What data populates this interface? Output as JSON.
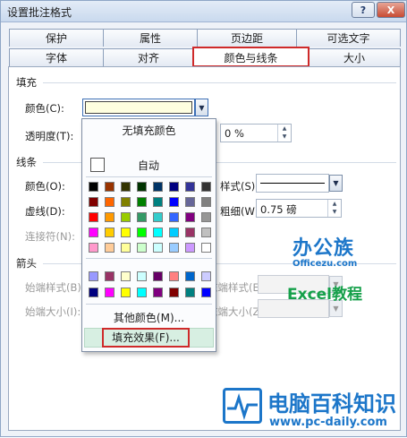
{
  "window": {
    "title": "设置批注格式",
    "help_label": "?",
    "close_label": "X"
  },
  "tabs": {
    "row1": [
      "保护",
      "属性",
      "页边距",
      "可选文字"
    ],
    "row2": [
      "字体",
      "对齐",
      "颜色与线条",
      "大小"
    ],
    "active": "颜色与线条"
  },
  "fill": {
    "section_label": "填充",
    "color_label": "颜色(C):",
    "color_value": "#ffffe0",
    "transparency_label": "透明度(T):",
    "transparency_value": "0 %"
  },
  "line": {
    "section_label": "线条",
    "color_label": "颜色(O):",
    "dash_label": "虚线(D):",
    "connector_label": "连接符(N):",
    "style_label": "样式(S):",
    "weight_label": "粗细(W):",
    "weight_value": "0.75 磅"
  },
  "arrows": {
    "section_label": "箭头",
    "begin_style_label": "始端样式(B):",
    "begin_size_label": "始端大小(I):",
    "end_style_label": "末端样式(E):",
    "end_size_label": "末端大小(Z):"
  },
  "color_menu": {
    "no_fill": "无填充颜色",
    "automatic": "自动",
    "main_colors": [
      [
        "#000000",
        "#993300",
        "#333300",
        "#003300",
        "#003366",
        "#000080",
        "#333399",
        "#333333"
      ],
      [
        "#800000",
        "#ff6600",
        "#808000",
        "#008000",
        "#008080",
        "#0000ff",
        "#666699",
        "#808080"
      ],
      [
        "#ff0000",
        "#ff9900",
        "#99cc00",
        "#339966",
        "#33cccc",
        "#3366ff",
        "#800080",
        "#969696"
      ],
      [
        "#ff00ff",
        "#ffcc00",
        "#ffff00",
        "#00ff00",
        "#00ffff",
        "#00ccff",
        "#993366",
        "#c0c0c0"
      ],
      [
        "#ff99cc",
        "#ffcc99",
        "#ffff99",
        "#ccffcc",
        "#ccffff",
        "#99ccff",
        "#cc99ff",
        "#ffffff"
      ]
    ],
    "extra_colors": [
      [
        "#9999ff",
        "#993366",
        "#ffffcc",
        "#ccffff",
        "#660066",
        "#ff8080",
        "#0066cc",
        "#ccccff"
      ],
      [
        "#000080",
        "#ff00ff",
        "#ffff00",
        "#00ffff",
        "#800080",
        "#800000",
        "#008080",
        "#0000ff"
      ]
    ],
    "more_colors": "其他颜色(M)...",
    "fill_effects": "填充效果(F)..."
  },
  "watermark": {
    "logo_text": "办公族",
    "logo_url": "Officezu.com",
    "logo_sub": "Excel教程",
    "brand_name": "电脑百科知识",
    "brand_url": "www.pc-daily.com"
  },
  "colors": {
    "highlight_red": "#cf2a2a",
    "watermark_blue": "#1c76c9",
    "brand_green": "#15a04a"
  }
}
